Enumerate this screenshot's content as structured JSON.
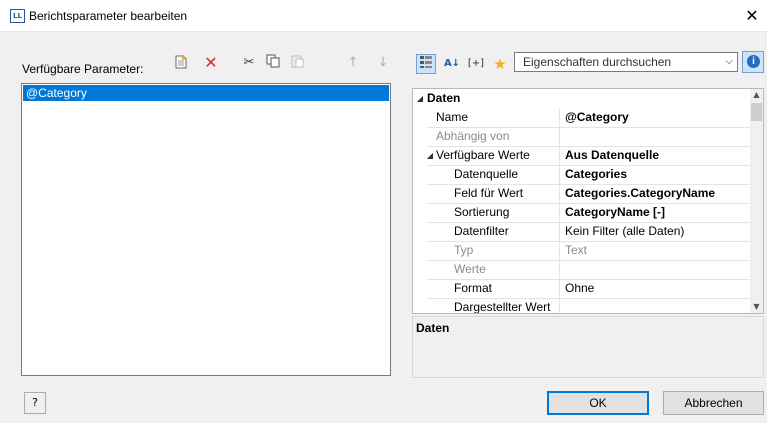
{
  "window": {
    "title": "Berichtsparameter bearbeiten",
    "icon_text": "LL",
    "close": "✕"
  },
  "left_panel": {
    "label": "Verfügbare Parameter:",
    "toolbar": [
      {
        "name": "new-parameter-icon",
        "glyph": "🗋",
        "enabled": true
      },
      {
        "name": "delete-icon",
        "glyph": "✕",
        "enabled": true,
        "color": "#e0262b"
      },
      {
        "name": "cut-icon",
        "glyph": "✂",
        "enabled": true
      },
      {
        "name": "copy-icon",
        "glyph": "⎘",
        "enabled": true
      },
      {
        "name": "paste-icon",
        "glyph": "📋",
        "enabled": false
      },
      {
        "name": "move-up-icon",
        "glyph": "↑",
        "enabled": false
      },
      {
        "name": "move-down-icon",
        "glyph": "↓",
        "enabled": false
      }
    ],
    "items": [
      "@Category"
    ]
  },
  "property_panel": {
    "toolbar": {
      "categorized_icon": "categorized-view-icon",
      "sort_icon": "sort-az-icon",
      "expand_icon": "expand-all-icon",
      "favorites_icon": "star-icon",
      "search_placeholder": "Eigenschaften durchsuchen",
      "info_icon": "info-icon"
    },
    "rows": [
      {
        "name": "Daten",
        "value": "",
        "type": "category"
      },
      {
        "name": "Name",
        "value": "@Category",
        "bold_value": true
      },
      {
        "name": "Abhängig von",
        "value": "",
        "grey": true
      },
      {
        "name": "Verfügbare Werte",
        "value": "Aus Datenquelle",
        "bold_value": true,
        "expander": "◢"
      },
      {
        "name": "Datenquelle",
        "value": "Categories",
        "bold_value": true,
        "indent": true
      },
      {
        "name": "Feld für Wert",
        "value": "Categories.CategoryName",
        "bold_value": true,
        "indent": true
      },
      {
        "name": "Sortierung",
        "value": "CategoryName [-]",
        "bold_value": true,
        "indent": true
      },
      {
        "name": "Datenfilter",
        "value": "Kein Filter (alle Daten)",
        "indent": true
      },
      {
        "name": "Typ",
        "value": "Text",
        "grey": true,
        "indent": true
      },
      {
        "name": "Werte",
        "value": "",
        "grey": true,
        "indent": true
      },
      {
        "name": "Format",
        "value": "Ohne",
        "indent": true
      },
      {
        "name": "Dargestellter Wert",
        "value": "",
        "indent": true
      }
    ],
    "description_title": "Daten"
  },
  "buttons": {
    "help": "?",
    "ok": "OK",
    "cancel": "Abbrechen"
  }
}
